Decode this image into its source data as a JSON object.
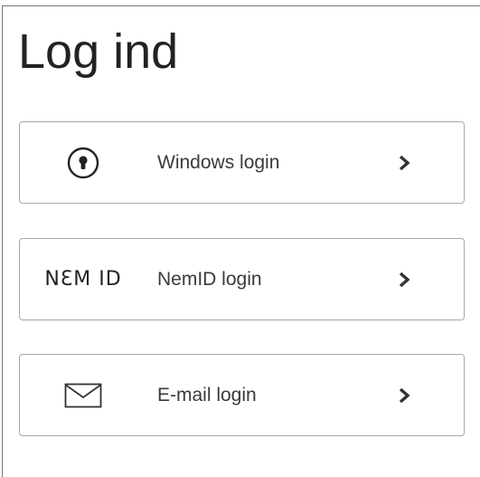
{
  "page": {
    "title": "Log ind"
  },
  "options": [
    {
      "label": "Windows login",
      "icon": "keyhole-lock-icon"
    },
    {
      "label": "NemID login",
      "icon": "nemid-logo-icon",
      "logo_text": "NƐM ID"
    },
    {
      "label": "E-mail login",
      "icon": "envelope-icon"
    }
  ],
  "arrow_icon": "chevron-right-icon",
  "colors": {
    "text": "#333333",
    "border": "#a8a8a8",
    "background": "#ffffff"
  }
}
